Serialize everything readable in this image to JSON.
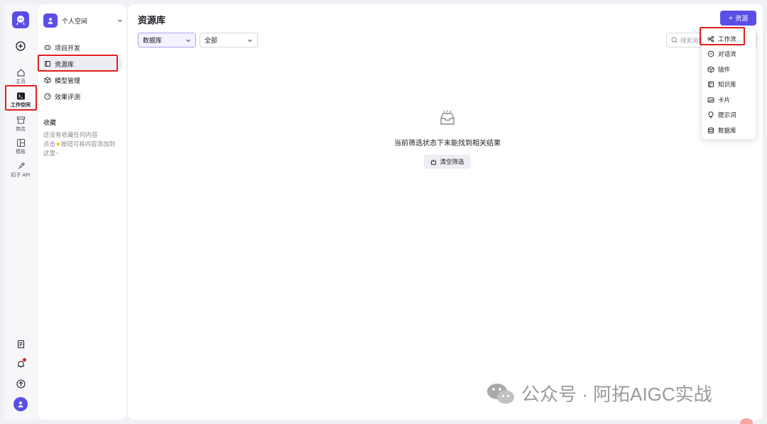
{
  "rail": {
    "items": [
      {
        "label": "主页",
        "icon": "home-icon"
      },
      {
        "label": "工作空间",
        "icon": "terminal-icon"
      },
      {
        "label": "商店",
        "icon": "store-icon"
      },
      {
        "label": "模板",
        "icon": "template-icon"
      },
      {
        "label": "扣子 API",
        "icon": "api-icon"
      }
    ]
  },
  "sidebar": {
    "space_name": "个人空间",
    "nav": [
      {
        "label": "项目开发"
      },
      {
        "label": "资源库"
      },
      {
        "label": "模型管理"
      },
      {
        "label": "效果评测"
      }
    ],
    "favorites_title": "收藏",
    "favorites_empty_line1": "还没有收藏任何内容",
    "favorites_empty_line2_prefix": "点击",
    "favorites_empty_line2_suffix": "按钮可将内容添加到",
    "favorites_empty_line3": "这里~"
  },
  "main": {
    "title": "资源库",
    "add_button": "资源",
    "filter_type": "数据库",
    "filter_scope": "全部",
    "search_placeholder": "搜索资源",
    "empty_text": "当前筛选状态下未能找到相关结果",
    "clear_filter": "清空筛选"
  },
  "menu": {
    "items": [
      {
        "label": "工作流"
      },
      {
        "label": "对话流"
      },
      {
        "label": "插件"
      },
      {
        "label": "知识库"
      },
      {
        "label": "卡片"
      },
      {
        "label": "提示词"
      },
      {
        "label": "数据库"
      }
    ]
  },
  "watermark": {
    "text": "公众号 · 阿拓AIGC实战"
  },
  "colors": {
    "accent": "#5b4ee6",
    "highlight": "#e02020"
  }
}
